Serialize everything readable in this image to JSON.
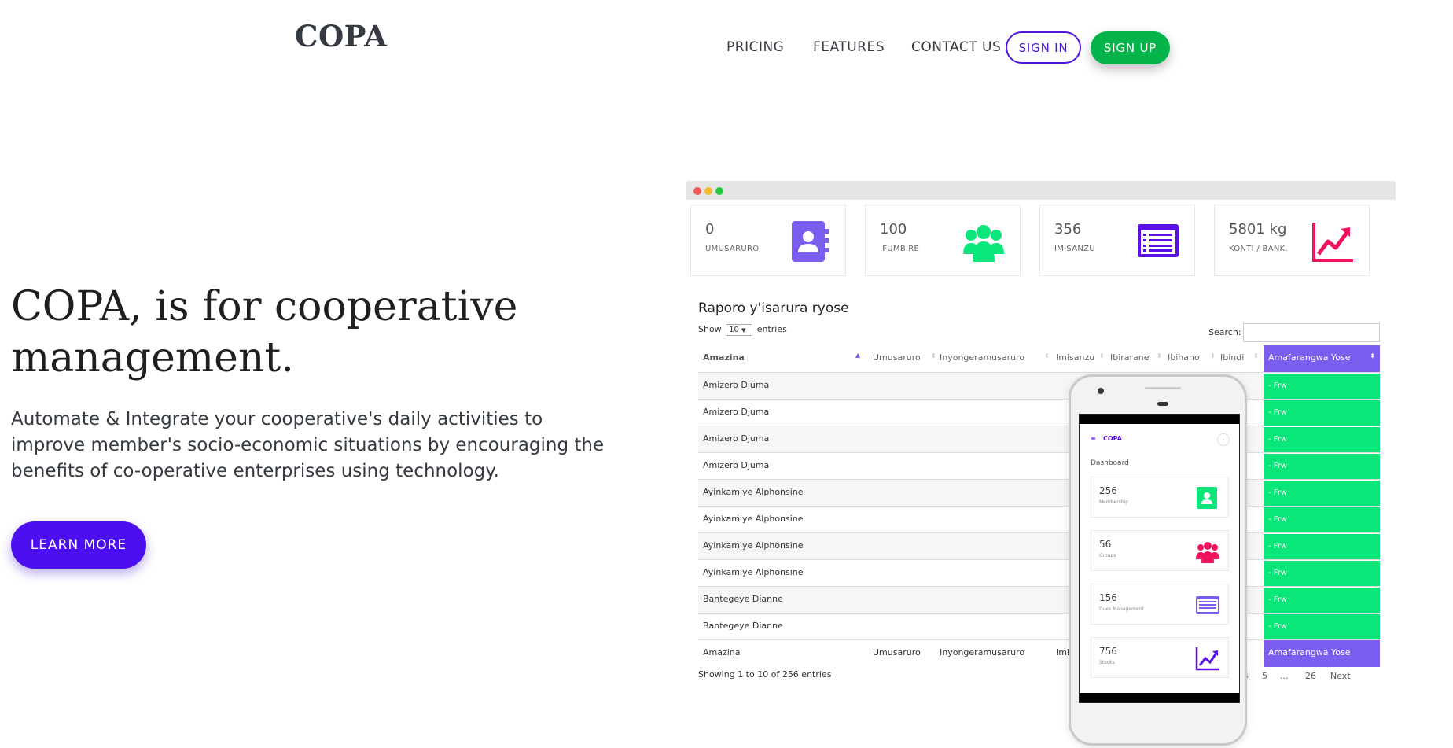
{
  "header": {
    "logo": "COPA",
    "nav": [
      {
        "label": "PRICING"
      },
      {
        "label": "FEATURES"
      },
      {
        "label": "CONTACT US"
      }
    ],
    "signin_label": "SIGN IN",
    "signup_label": "SIGN UP"
  },
  "hero": {
    "title": "COPA, is for cooperative management.",
    "subtitle": "Automate & Integrate your cooperative's daily activities to improve member's socio-economic situations by encouraging the benefits of co-operative enterprises using technology.",
    "cta_label": "LEARN MORE"
  },
  "dashboard": {
    "stats": [
      {
        "value": "0",
        "label": "UMUSARURO",
        "icon": "contact-book-icon",
        "color": "#7b5df0"
      },
      {
        "value": "100",
        "label": "IFUMBIRE",
        "icon": "group-icon",
        "color": "#0be67a"
      },
      {
        "value": "356",
        "label": "IMISANZU",
        "icon": "list-icon",
        "color": "#5b10e6"
      },
      {
        "value": "5801 kg",
        "label": "KONTI / BANK.",
        "icon": "trend-up-icon",
        "color": "#f0125e"
      }
    ],
    "table": {
      "title": "Raporo y'isarura ryose",
      "show_label": "Show",
      "page_size": "10",
      "entries_label": "entries",
      "search_label": "Search:",
      "columns": [
        "Amazina",
        "Umusaruro",
        "Inyongeramusaruro",
        "Imisanzu",
        "Ibirarane",
        "Ibihano",
        "Ibindi",
        "Amafarangwa Yose"
      ],
      "rows": [
        {
          "name": "Amizero Djuma",
          "amount": "- Frw"
        },
        {
          "name": "Amizero Djuma",
          "amount": "- Frw"
        },
        {
          "name": "Amizero Djuma",
          "amount": "- Frw"
        },
        {
          "name": "Amizero Djuma",
          "amount": "- Frw"
        },
        {
          "name": "Ayinkamiye Alphonsine",
          "amount": "- Frw"
        },
        {
          "name": "Ayinkamiye Alphonsine",
          "amount": "- Frw"
        },
        {
          "name": "Ayinkamiye Alphonsine",
          "amount": "- Frw"
        },
        {
          "name": "Ayinkamiye Alphonsine",
          "amount": "- Frw"
        },
        {
          "name": "Bantegeye Dianne",
          "amount": "- Frw"
        },
        {
          "name": "Bantegeye Dianne",
          "amount": "- Frw"
        }
      ],
      "footer": [
        "Amazina",
        "Umusaruro",
        "Inyongeramusaruro",
        "Imis",
        "Amafarangwa Yose"
      ],
      "showing": "Showing 1 to 10 of 256 entries",
      "pagination": [
        "4",
        "5",
        "...",
        "26",
        "Next"
      ]
    }
  },
  "phone": {
    "brand": "COPA",
    "menu_icon": "hamburger-icon",
    "heading": "Dashboard",
    "cards": [
      {
        "value": "256",
        "label": "Membership",
        "icon": "contact-book-icon",
        "color": "#0be67a"
      },
      {
        "value": "56",
        "label": "Groups",
        "icon": "group-icon",
        "color": "#f0125e"
      },
      {
        "value": "156",
        "label": "Dues Management",
        "icon": "list-icon",
        "color": "#7b5df0"
      },
      {
        "value": "756",
        "label": "Stocks",
        "icon": "trend-up-icon",
        "color": "#5b10e6"
      }
    ]
  },
  "colors": {
    "brand_purple": "#4b0ff0",
    "brand_green": "#04b34a",
    "table_green": "#0be67a",
    "table_purple": "#7b5df0"
  }
}
